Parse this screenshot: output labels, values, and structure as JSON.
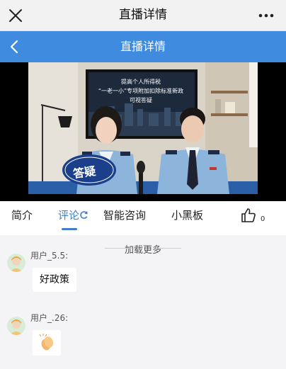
{
  "app_header": {
    "title": "直播详情",
    "close_icon": "close-icon",
    "more_icon": "more-horizontal-icon"
  },
  "blue_header": {
    "title": "直播详情",
    "back_icon": "chevron-left-icon",
    "color": "#3f8be0"
  },
  "video": {
    "screen_lines": [
      "提高个人所得税",
      "“一老一小”专项附加扣除标准新政",
      "可视答疑"
    ],
    "sign_text": "答疑"
  },
  "tabs": [
    {
      "label": "简介",
      "active": false
    },
    {
      "label": "评论",
      "active": true,
      "icon": "refresh-icon"
    },
    {
      "label": "智能咨询",
      "active": false
    },
    {
      "label": "小黑板",
      "active": false
    }
  ],
  "like": {
    "icon": "thumbs-up-icon",
    "count": "0"
  },
  "load_more": "加载更多",
  "comments": [
    {
      "username": "用户_5.5:",
      "text": "好政策",
      "avatar": "user-avatar-icon"
    },
    {
      "username": "用户_.26:",
      "emoji": "clapping-hands-emoji",
      "avatar": "user-avatar-icon"
    }
  ],
  "accent_color": "#3f7fc9"
}
